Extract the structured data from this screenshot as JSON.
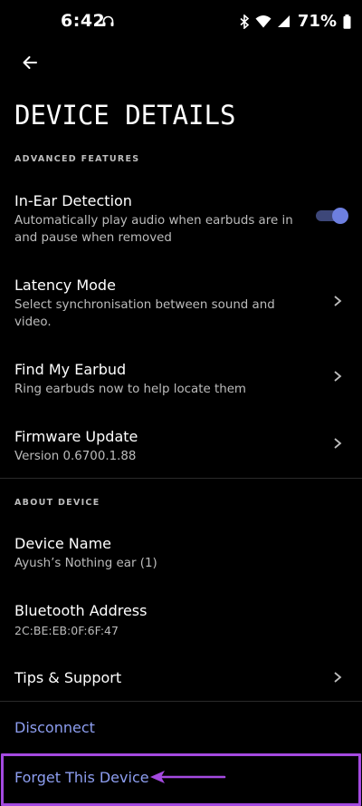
{
  "status": {
    "time": "6:42",
    "battery": "71%",
    "icons": [
      "headphones-icon",
      "bluetooth-icon",
      "wifi-icon",
      "signal-icon",
      "battery-icon"
    ]
  },
  "header": {
    "back_icon": "back-arrow-icon",
    "title": "DEVICE DETAILS"
  },
  "advanced": {
    "heading": "ADVANCED FEATURES",
    "in_ear": {
      "title": "In-Ear Detection",
      "subtitle": "Automatically play audio when earbuds are in and pause when removed",
      "enabled": true
    },
    "latency": {
      "title": "Latency Mode",
      "subtitle": "Select synchronisation between sound and video."
    },
    "find": {
      "title": "Find My Earbud",
      "subtitle": "Ring earbuds now to help locate them"
    },
    "firmware": {
      "title": "Firmware Update",
      "subtitle": "Version 0.6700.1.88"
    }
  },
  "about": {
    "heading": "ABOUT DEVICE",
    "name": {
      "title": "Device Name",
      "value": "Ayush’s Nothing ear (1)"
    },
    "bt": {
      "title": "Bluetooth Address",
      "value": "2C:BE:EB:0F:6F:47"
    },
    "tips": {
      "title": "Tips & Support"
    }
  },
  "actions": {
    "disconnect": "Disconnect",
    "forget": "Forget This Device"
  },
  "colors": {
    "accent": "#8d9ef0",
    "toggle_knob": "#6d7fe0",
    "highlight": "#a44ae0"
  }
}
